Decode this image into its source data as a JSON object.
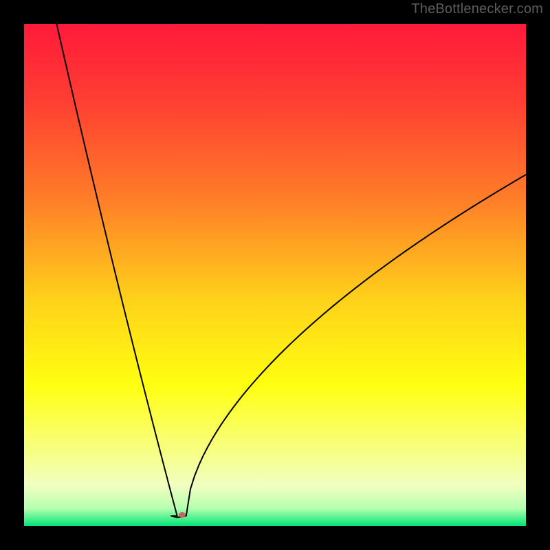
{
  "attribution": "TheBottlenecker.com",
  "chart_data": {
    "type": "line",
    "title": "",
    "xlabel": "",
    "ylabel": "",
    "xlim": [
      0,
      100
    ],
    "ylim": [
      0,
      100
    ],
    "background_gradient": {
      "stops": [
        {
          "offset": 0.0,
          "color": "#ff1a3a"
        },
        {
          "offset": 0.15,
          "color": "#ff3d32"
        },
        {
          "offset": 0.35,
          "color": "#ff7e28"
        },
        {
          "offset": 0.55,
          "color": "#ffd21a"
        },
        {
          "offset": 0.72,
          "color": "#ffff10"
        },
        {
          "offset": 0.84,
          "color": "#f8ff7a"
        },
        {
          "offset": 0.92,
          "color": "#f0ffc0"
        },
        {
          "offset": 0.965,
          "color": "#b6ffb0"
        },
        {
          "offset": 1.0,
          "color": "#00e676"
        }
      ]
    },
    "curve": {
      "optimum_x": 30.5,
      "optimum_y": 2.0,
      "left": {
        "x0": 6.5,
        "y0": 100.0
      },
      "right": {
        "x_end": 100.0,
        "y_end": 70.0,
        "curvature": 0.58
      },
      "stroke": "#000000",
      "stroke_width": 2.0
    },
    "marker": {
      "x": 31.5,
      "y": 2.2,
      "rx": 5,
      "ry": 4,
      "fill": "#c5655b"
    }
  }
}
